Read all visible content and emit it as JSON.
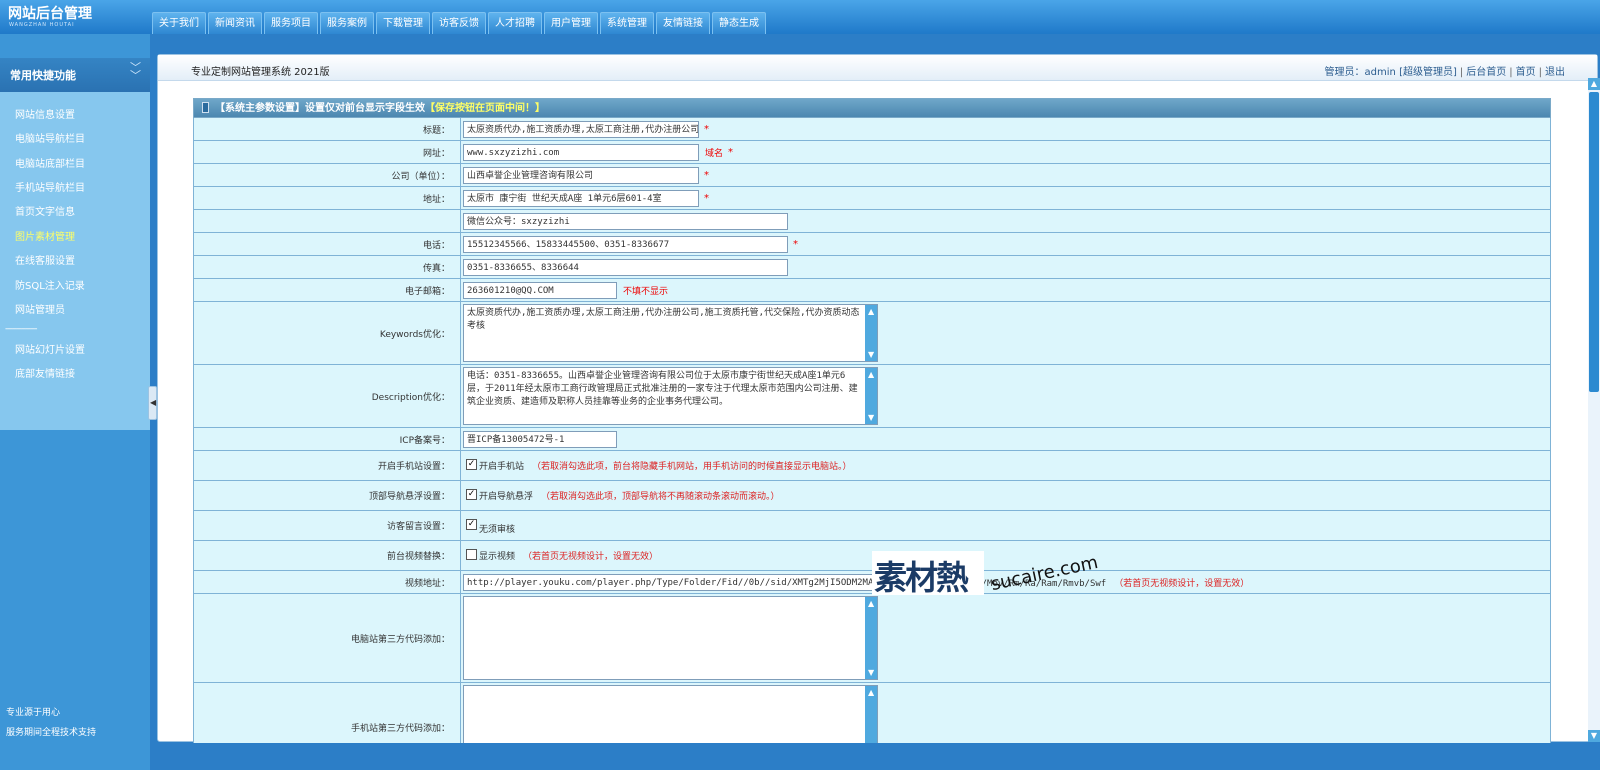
{
  "logo": {
    "title": "网站后台管理",
    "subtitle": "WANGZHAN HOUTAI"
  },
  "nav": [
    "关于我们",
    "新闻资讯",
    "服务项目",
    "服务案例",
    "下载管理",
    "访客反馈",
    "人才招聘",
    "用户管理",
    "系统管理",
    "友情链接",
    "静态生成"
  ],
  "sidebar": {
    "title": "常用快捷功能",
    "items": [
      {
        "label": "网站信息设置"
      },
      {
        "label": "电脑站导航栏目"
      },
      {
        "label": "电脑站底部栏目"
      },
      {
        "label": "手机站导航栏目"
      },
      {
        "label": "首页文字信息"
      },
      {
        "label": "图片素材管理",
        "active": true
      },
      {
        "label": "在线客服设置"
      },
      {
        "label": "防SQL注入记录"
      },
      {
        "label": "网站管理员"
      },
      {
        "label": "网站幻灯片设置"
      },
      {
        "label": "底部友情链接"
      }
    ],
    "separator": "--------------",
    "footer": [
      "专业源于用心",
      "服务期间全程技术支持"
    ]
  },
  "header": {
    "system_title": "专业定制网站管理系统 2021版",
    "admin_prefix": "管理员：",
    "admin_name": "admin",
    "admin_role": "[超级管理员]",
    "links": [
      "后台首页",
      "首页",
      "退出"
    ]
  },
  "form": {
    "head_title": "【系统主参数设置】设置仅对前台显示字段生效",
    "head_note": "【保存按钮在页面中间！】",
    "fields": {
      "title": {
        "label": "标题：",
        "value": "太原资质代办,施工资质办理,太原工商注册,代办注册公司"
      },
      "url": {
        "label": "网址：",
        "value": "www.sxzyzizhi.com",
        "hint": "域名"
      },
      "company": {
        "label": "公司（单位）：",
        "value": "山西卓誉企业管理咨询有限公司"
      },
      "address": {
        "label": "地址：",
        "value": "太原市 康宁街 世纪天成A座 1单元6层601-4室"
      },
      "wechat": {
        "label": "",
        "value": "微信公众号：sxzyzizhi"
      },
      "phone": {
        "label": "电话：",
        "value": "15512345566、15833445500、0351-8336677"
      },
      "fax": {
        "label": "传真：",
        "value": "0351-8336655、8336644"
      },
      "email": {
        "label": "电子邮箱：",
        "value": "263601210@QQ.COM",
        "hint": "不填不显示"
      },
      "keywords": {
        "label": "Keywords优化：",
        "value": "太原资质代办,施工资质办理,太原工商注册,代办注册公司,施工资质托管,代交保险,代办资质动态考核"
      },
      "description": {
        "label": "Description优化：",
        "value": "电话：0351-8336655。山西卓誉企业管理咨询有限公司位于太原市康宁街世纪天成A座1单元6层，于2011年经太原市工商行政管理局正式批准注册的一家专注于代理太原市范围内公司注册、建筑企业资质、建造师及职称人员挂靠等业务的企业事务代理公司。"
      },
      "icp": {
        "label": "ICP备案号：",
        "value": "晋ICP备13005472号-1"
      },
      "mobile_site": {
        "label": "开启手机站设置：",
        "check_label": "开启手机站",
        "checked": true,
        "hint": "（若取消勾选此项，前台将隐藏手机网站，用手机访问的时候直接显示电脑站。）"
      },
      "float_nav": {
        "label": "顶部导航悬浮设置：",
        "check_label": "开启导航悬浮",
        "checked": true,
        "hint": "（若取消勾选此项，顶部导航将不再随滚动条滚动而滚动。）"
      },
      "guestbook": {
        "label": "访客留言设置：",
        "check_label": "无须审核",
        "checked": true
      },
      "video_swap": {
        "label": "前台视频替换：",
        "check_label": "显示视频",
        "checked": false,
        "hint": "（若首页无视频设计，设置无效）"
      },
      "video_url": {
        "label": "视频地址：",
        "value": "http://player.youku.com/player.php/Type/Folder/Fid//0b//sid/XMTg2MjI5ODM2MA==/v.swf",
        "formats": "支持格式：Avi/Wmv/Asf/Mov/Rm/Ra/Ram/Rmvb/Swf",
        "hint": "（若首页无视频设计，设置无效）"
      },
      "pc_code": {
        "label": "电脑站第三方代码添加：",
        "value": ""
      },
      "mobile_code": {
        "label": "手机站第三方代码添加：",
        "value": ""
      }
    }
  },
  "watermark": {
    "cn": "素材熱",
    "en": "sucaire.com"
  },
  "colors": {
    "topbar": "#1f79c9",
    "sidebar": "#3d96d7",
    "row_bg": "#dcf6fc",
    "required": "#e00000",
    "active_menu": "#ffff66"
  }
}
